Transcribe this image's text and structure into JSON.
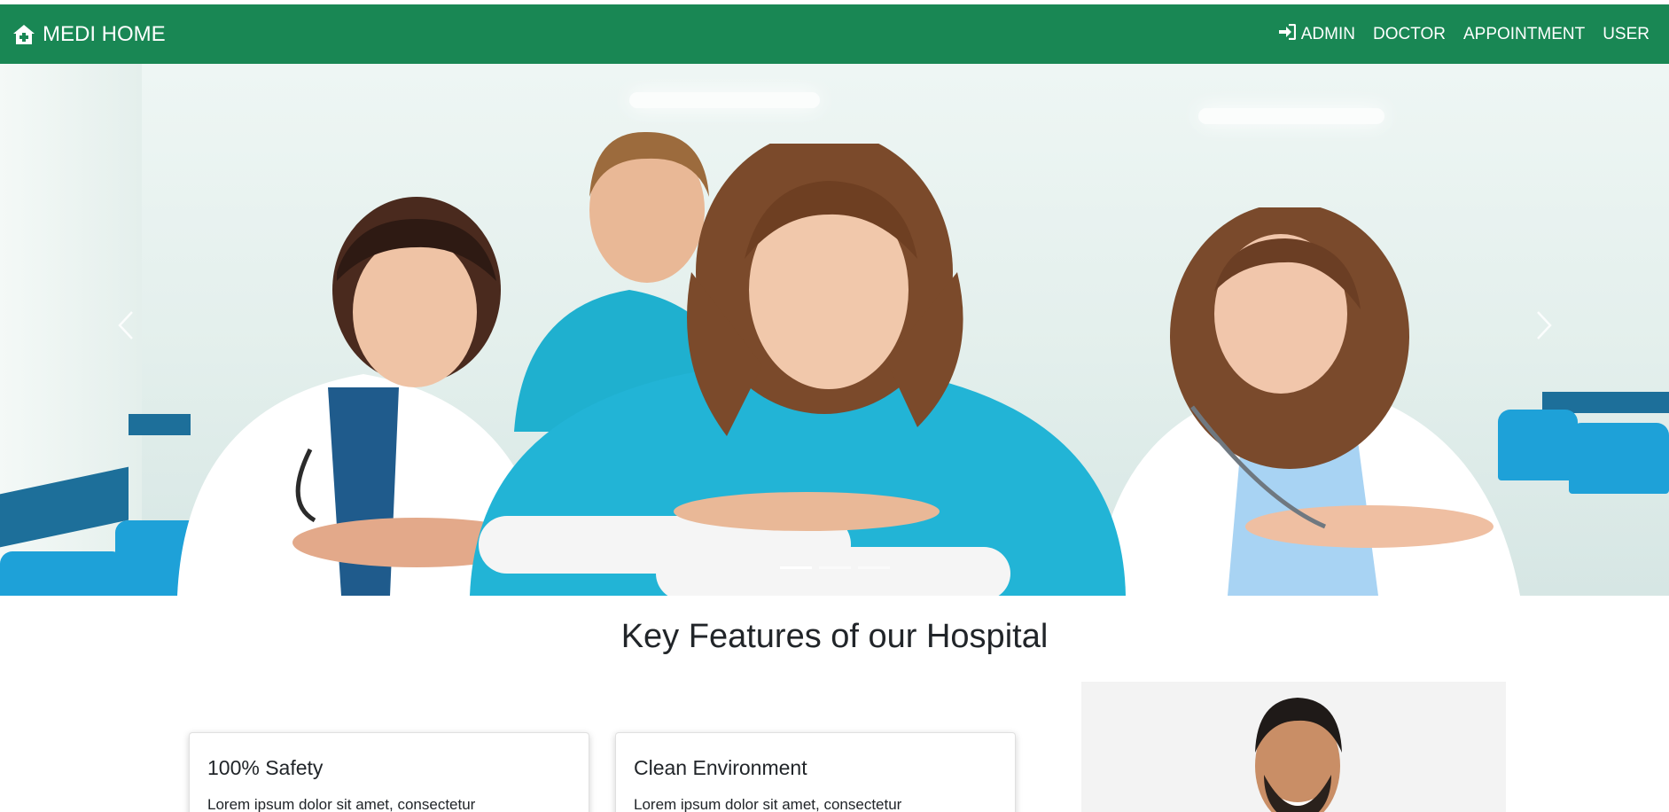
{
  "navbar": {
    "brand": "MEDI HOME",
    "brand_icon": "house-medical-icon",
    "bg_color": "#198754",
    "links": [
      {
        "label": "ADMIN",
        "icon": "sign-in-icon"
      },
      {
        "label": "DOCTOR"
      },
      {
        "label": "APPOINTMENT"
      },
      {
        "label": "USER"
      }
    ]
  },
  "carousel": {
    "slide_count": 3,
    "active_slide": 1,
    "prev_icon": "chevron-left-icon",
    "next_icon": "chevron-right-icon"
  },
  "features": {
    "title": "Key Features of our Hospital",
    "cards": [
      {
        "title": "100% Safety",
        "text": "Lorem ipsum dolor sit amet, consectetur"
      },
      {
        "title": "Clean Environment",
        "text": "Lorem ipsum dolor sit amet, consectetur"
      }
    ]
  }
}
